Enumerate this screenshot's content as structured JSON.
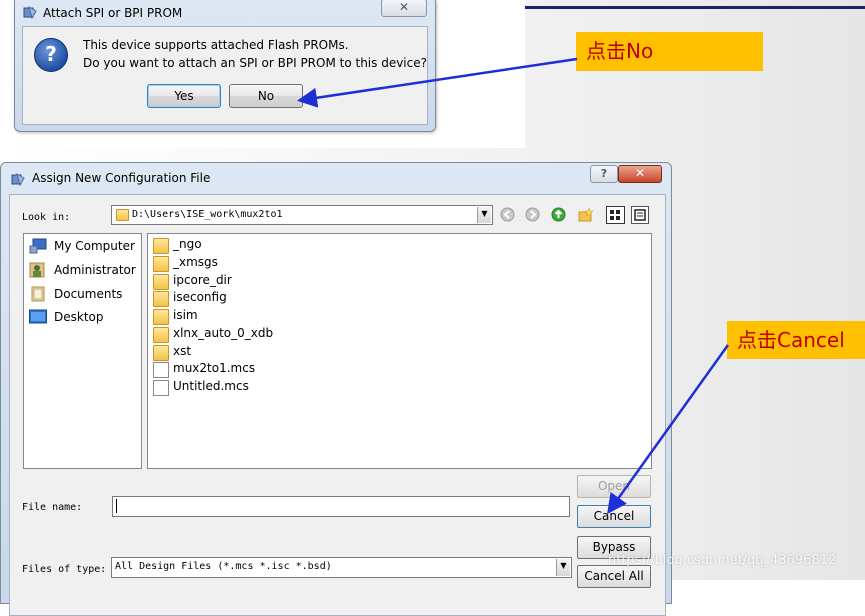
{
  "attach_dialog": {
    "title": "Attach SPI or BPI PROM",
    "close_glyph": "✕",
    "question_glyph": "?",
    "message_line1": "This device supports attached Flash PROMs.",
    "message_line2": "Do you want to attach an SPI or BPI PROM to this device?",
    "yes_label": "Yes",
    "no_label": "No"
  },
  "assign_dialog": {
    "title": "Assign New Configuration File",
    "help_glyph": "?",
    "close_glyph": "✕",
    "look_in_label": "Look in:",
    "look_in_value": "D:\\Users\\ISE_work\\mux2to1",
    "places": [
      {
        "label": "My Computer",
        "icon": "my-computer-icon"
      },
      {
        "label": "Administrator",
        "icon": "user-icon"
      },
      {
        "label": "Documents",
        "icon": "documents-icon"
      },
      {
        "label": "Desktop",
        "icon": "desktop-icon"
      }
    ],
    "files": [
      {
        "name": "_ngo",
        "type": "folder"
      },
      {
        "name": "_xmsgs",
        "type": "folder"
      },
      {
        "name": "ipcore_dir",
        "type": "folder"
      },
      {
        "name": "iseconfig",
        "type": "folder"
      },
      {
        "name": "isim",
        "type": "folder"
      },
      {
        "name": "xlnx_auto_0_xdb",
        "type": "folder"
      },
      {
        "name": "xst",
        "type": "folder"
      },
      {
        "name": "mux2to1.mcs",
        "type": "file"
      },
      {
        "name": "Untitled.mcs",
        "type": "file"
      }
    ],
    "file_name_label": "File name:",
    "file_name_value": "",
    "files_of_type_label": "Files of type:",
    "files_of_type_value": "All Design Files (*.mcs *.isc *.bsd)",
    "open_label": "Open",
    "cancel_label": "Cancel",
    "bypass_label": "Bypass",
    "cancel_all_label": "Cancel All"
  },
  "annotations": {
    "click_no": "点击No",
    "click_cancel": "点击Cancel"
  },
  "watermark": "https://blog.csdn.net/qq_43696812",
  "colors": {
    "callout_bg": "#ffc000",
    "callout_text": "#c00000",
    "arrow": "#1f2fd6"
  }
}
